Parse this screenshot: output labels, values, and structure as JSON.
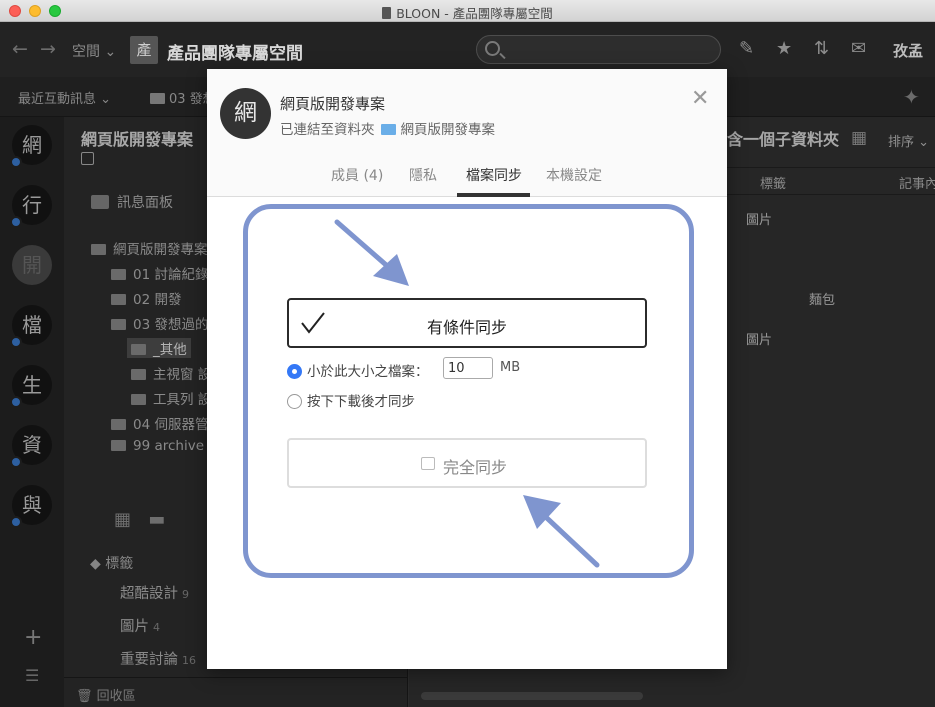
{
  "window": {
    "title": "BLOON - 產品團隊專屬空間"
  },
  "toolbar": {
    "space_label": "空間",
    "space_avatar": "產",
    "space_title": "產品團隊專屬空間",
    "user": "孜孟"
  },
  "subbar": {
    "recent": "最近互動訊息",
    "crumb": "03 發想"
  },
  "rail": {
    "avatars": [
      "網",
      "行",
      "開",
      "檔",
      "生",
      "資",
      "與"
    ]
  },
  "sidebar": {
    "title": "網頁版開發專案",
    "board": "訊息面板",
    "tree": [
      {
        "label": "網頁版開發專案"
      },
      {
        "label": "01 討論紀錄"
      },
      {
        "label": "02 開發"
      },
      {
        "label": "03 發想過的"
      },
      {
        "label": "_其他"
      },
      {
        "label": "主視窗 設"
      },
      {
        "label": "工具列 設"
      },
      {
        "label": "04 伺服器管"
      },
      {
        "label": "99 archive"
      }
    ],
    "tags_label": "標籤",
    "tags": [
      {
        "name": "超酷設計",
        "count": "9"
      },
      {
        "name": "圖片",
        "count": "4"
      },
      {
        "name": "重要討論",
        "count": "16"
      }
    ],
    "trash": "回收區"
  },
  "main": {
    "heading": "含一個子資料夾",
    "sort": "排序",
    "col_tag": "標籤",
    "col_note": "記事內",
    "cells": [
      "圖片",
      "麵包",
      "圖片"
    ]
  },
  "modal": {
    "avatar": "網",
    "title": "網頁版開發專案",
    "subtitle_prefix": "已連結至資料夾",
    "subtitle_folder": "網頁版開發專案",
    "tabs": [
      {
        "label": "成員 (4)"
      },
      {
        "label": "隱私"
      },
      {
        "label": "檔案同步"
      },
      {
        "label": "本機設定"
      }
    ],
    "active_tab": "檔案同步",
    "conditional_sync_label": "有條件同步",
    "option_size_label": "小於此大小之檔案：",
    "size_value": "10",
    "size_unit": "MB",
    "option_manual_label": "按下下載後才同步",
    "full_sync_label": "完全同步"
  },
  "colors": {
    "annotation": "#7f95cf",
    "accent": "#3478f6"
  }
}
